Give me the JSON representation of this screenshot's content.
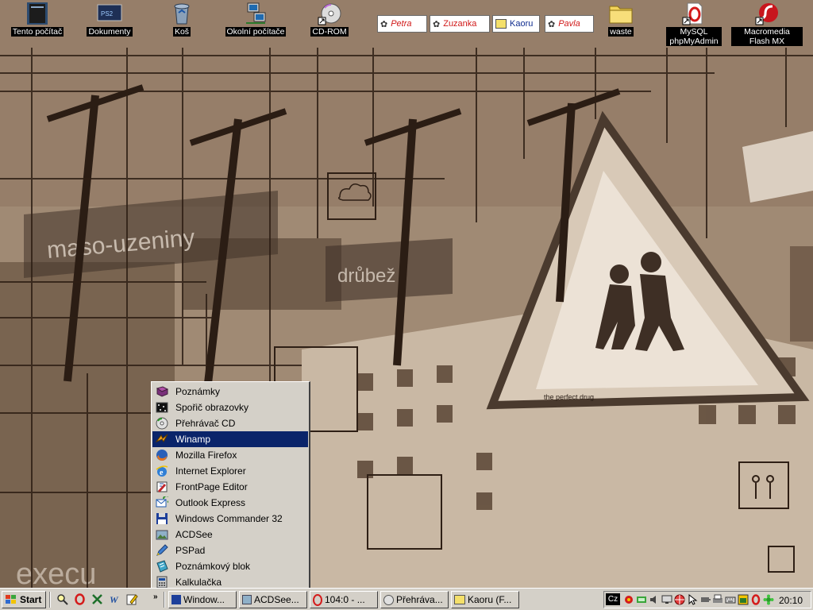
{
  "desktop_icons": [
    {
      "label": "Tento počítač",
      "icon": "computer-icon"
    },
    {
      "label": "Dokumenty",
      "icon": "documents-icon"
    },
    {
      "label": "Koš",
      "icon": "recycle-bin-icon"
    },
    {
      "label": "Okolní počítače",
      "icon": "network-icon"
    },
    {
      "label": "CD-ROM",
      "icon": "cd-rom-icon"
    },
    {
      "label": "waste",
      "icon": "folder-icon"
    },
    {
      "label": "MySQL phpMyAdmin",
      "icon": "opera-icon"
    },
    {
      "label": "Macromedia Flash MX",
      "icon": "flash-icon"
    }
  ],
  "contacts": [
    "Petra",
    "Zuzanka",
    "Kaoru",
    "Pavla"
  ],
  "wallpaper": {
    "caption": "the perfect drug",
    "sign": "maso-uzeniny",
    "sign2": "drůbež",
    "corner": "execu"
  },
  "start_menu": {
    "items": [
      {
        "label": "Poznámky",
        "icon": "book-icon"
      },
      {
        "label": "Spořič obrazovky",
        "icon": "screensaver-icon"
      },
      {
        "label": "Přehrávač CD",
        "icon": "cd-player-icon"
      },
      {
        "label": "Winamp",
        "icon": "winamp-icon"
      },
      {
        "label": "Mozilla Firefox",
        "icon": "firefox-icon"
      },
      {
        "label": "Internet Explorer",
        "icon": "ie-icon"
      },
      {
        "label": "FrontPage Editor",
        "icon": "frontpage-icon"
      },
      {
        "label": "Outlook Express",
        "icon": "outlook-icon"
      },
      {
        "label": "Windows Commander 32",
        "icon": "floppy-icon"
      },
      {
        "label": "ACDSee",
        "icon": "acdsee-icon"
      },
      {
        "label": "PSPad",
        "icon": "pspad-icon"
      },
      {
        "label": "Poznámkový blok",
        "icon": "notepad-icon"
      },
      {
        "label": "Kalkulačka",
        "icon": "calculator-icon"
      }
    ],
    "selected": "Winamp"
  },
  "taskbar": {
    "start_label": "Start",
    "quick_launch": [
      "search-icon",
      "opera-icon",
      "excel-icon",
      "word-icon",
      "edit-icon"
    ],
    "chevron": "»",
    "buttons": [
      "Window...",
      "ACDSee...",
      "104:0 - ...",
      "Přehráva...",
      "Kaoru (F..."
    ],
    "tray": {
      "language": "Cz",
      "clock": "20:10"
    }
  },
  "colors": {
    "taskbar": "#d4d0c8",
    "selection": "#0a246a",
    "desktop_label_bg": "#000000",
    "contact_name": "#d01818"
  }
}
